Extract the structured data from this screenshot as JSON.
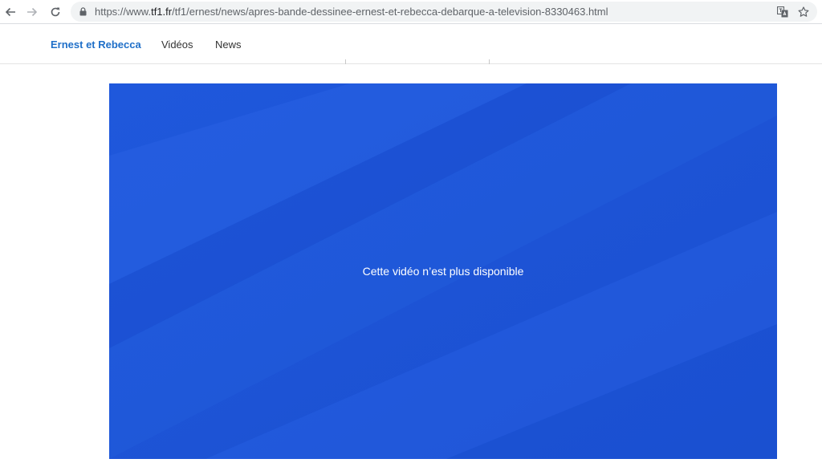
{
  "browser": {
    "url_scheme": "https://www.",
    "url_domain": "tf1.fr",
    "url_path": "/tf1/ernest/news/apres-bande-dessinee-ernest-et-rebecca-debarque-a-television-8330463.html"
  },
  "site_nav": {
    "brand": "Ernest et Rebecca",
    "links": [
      "Vidéos",
      "News"
    ]
  },
  "video": {
    "message": "Cette vidéo n’est plus disponible"
  },
  "colors": {
    "brand": "#1f6fc8",
    "video_background": "#1d53d6"
  }
}
